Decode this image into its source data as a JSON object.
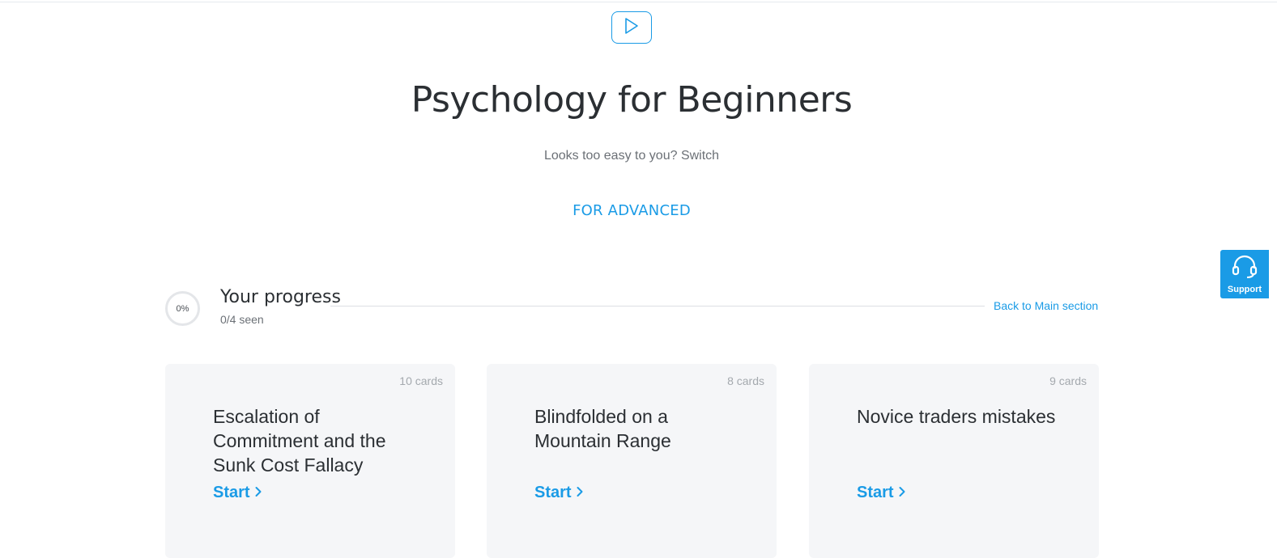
{
  "header": {
    "title": "Psychology for Beginners",
    "switch_text": "Looks too easy to you? Switch",
    "advanced_link": "FOR ADVANCED"
  },
  "progress": {
    "percent_label": "0%",
    "title": "Your progress",
    "seen": "0/4 seen",
    "back_link": "Back to Main section"
  },
  "cards": [
    {
      "count": "10 cards",
      "title": "Escalation of Commitment and the Sunk Cost Fallacy",
      "start": "Start"
    },
    {
      "count": "8 cards",
      "title": "Blindfolded on a Mountain Range",
      "start": "Start"
    },
    {
      "count": "9 cards",
      "title": "Novice traders mistakes",
      "start": "Start"
    }
  ],
  "support": {
    "label": "Support",
    "icon": "headset-icon"
  },
  "icons": {
    "play": "play-icon",
    "chevron": "chevron-right-icon"
  },
  "colors": {
    "accent": "#1a9be6",
    "text": "#2b2f33",
    "card_bg": "#f5f6f8"
  }
}
